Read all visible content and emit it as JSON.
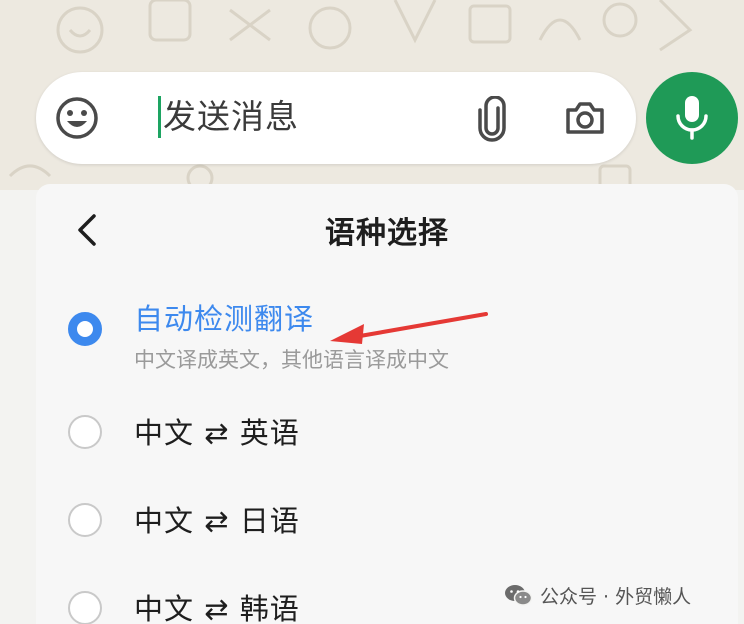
{
  "composer": {
    "placeholder": "发送消息",
    "emoji_icon": "emoji-icon",
    "attach_icon": "paperclip-icon",
    "camera_icon": "camera-icon",
    "mic_icon": "microphone-icon"
  },
  "language_panel": {
    "title": "语种选择",
    "options": [
      {
        "label": "自动检测翻译",
        "sublabel": "中文译成英文，其他语言译成中文",
        "selected": true
      },
      {
        "label": "中文 ⇄ 英语",
        "selected": false
      },
      {
        "label": "中文 ⇄ 日语",
        "selected": false
      },
      {
        "label": "中文 ⇄ 韩语",
        "selected": false
      }
    ]
  },
  "watermark": {
    "text": "公众号 · 外贸懒人"
  },
  "colors": {
    "accent_green": "#1f9a57",
    "selection_blue": "#3d89ee",
    "annotation_red": "#e53935"
  }
}
